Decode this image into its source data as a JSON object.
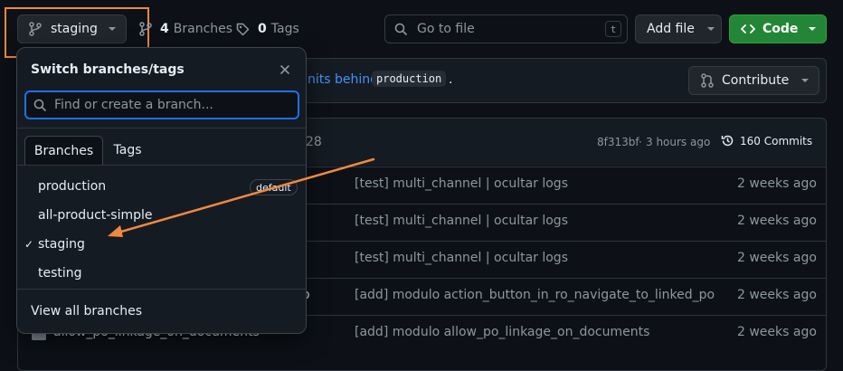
{
  "toolbar": {
    "branch_label": "staging",
    "branches_count": "4",
    "branches_label": "Branches",
    "tags_count": "0",
    "tags_label": "Tags",
    "search_placeholder": "Go to file",
    "search_shortcut": "t",
    "add_file_label": "Add file",
    "code_label": "Code"
  },
  "banner": {
    "text_visible": "nits behind",
    "branch_ref": "production",
    "period": ".",
    "contribute_label": "Contribute"
  },
  "commit_header": {
    "partial": "28",
    "hash": "8f313bf",
    "separator": "·",
    "time": "3 hours ago",
    "commits_label": "160 Commits"
  },
  "file_rows": [
    {
      "name": "",
      "message": "[test] multi_channel | ocultar logs",
      "time": "2 weeks ago"
    },
    {
      "name": "",
      "message": "[test] multi_channel | ocultar logs",
      "time": "2 weeks ago"
    },
    {
      "name": "",
      "message": "[test] multi_channel | ocultar logs",
      "time": "2 weeks ago"
    },
    {
      "name": "o",
      "message": "[add] modulo action_button_in_ro_navigate_to_linked_po",
      "time": "2 weeks ago"
    },
    {
      "name": "allow_po_linkage_on_documents",
      "message": "[add] modulo allow_po_linkage_on_documents",
      "time": "2 weeks ago"
    }
  ],
  "dropdown": {
    "title": "Switch branches/tags",
    "search_placeholder": "Find or create a branch...",
    "tabs": [
      "Branches",
      "Tags"
    ],
    "branches": [
      {
        "name": "production",
        "badge": "default",
        "selected": false
      },
      {
        "name": "all-product-simple",
        "badge": "",
        "selected": false
      },
      {
        "name": "staging",
        "badge": "",
        "selected": true
      },
      {
        "name": "testing",
        "badge": "",
        "selected": false
      }
    ],
    "checkmark": "✓",
    "view_all_label": "View all branches"
  },
  "colors": {
    "background": "#0d1117",
    "accent_orange": "#f0883e",
    "code_green": "#238636",
    "link_blue": "#4493f8"
  }
}
